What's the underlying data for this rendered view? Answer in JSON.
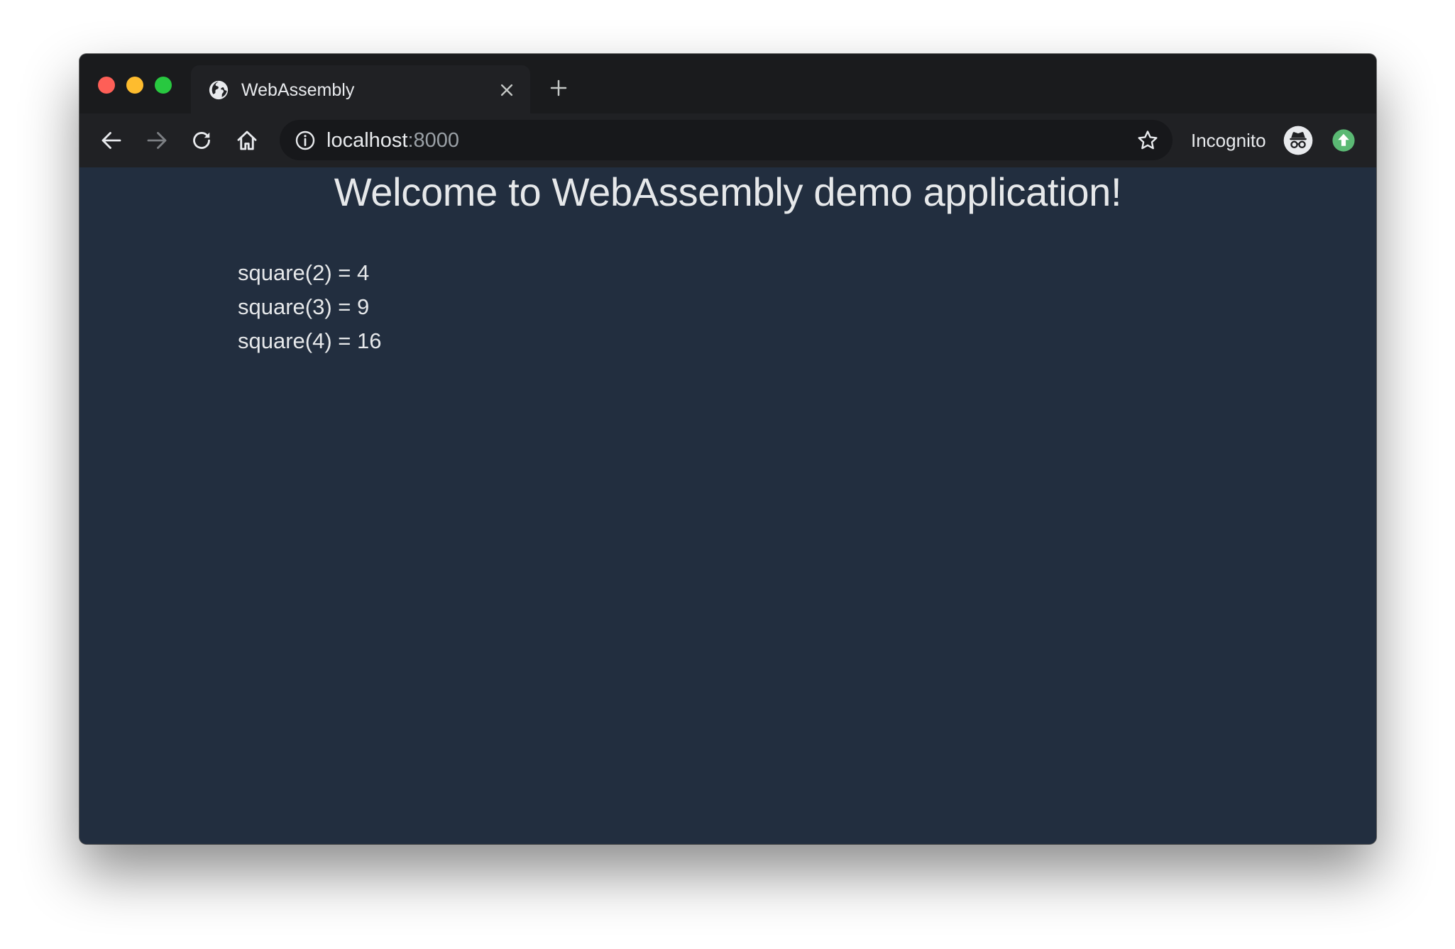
{
  "tab": {
    "title": "WebAssembly",
    "favicon": "globe-icon"
  },
  "toolbar": {
    "url_host": "localhost",
    "url_port": ":8000",
    "profile_label": "Incognito"
  },
  "page": {
    "heading": "Welcome to WebAssembly demo application!",
    "results": [
      "square(2) = 4",
      "square(3) = 9",
      "square(4) = 16"
    ]
  },
  "colors": {
    "page_background": "#222e3f",
    "tabstrip": "#1a1b1d",
    "toolbar": "#202124",
    "traffic_close": "#fe5f57",
    "traffic_minimize": "#febc2e",
    "traffic_maximize": "#28c840",
    "update_badge": "#5bb974"
  }
}
